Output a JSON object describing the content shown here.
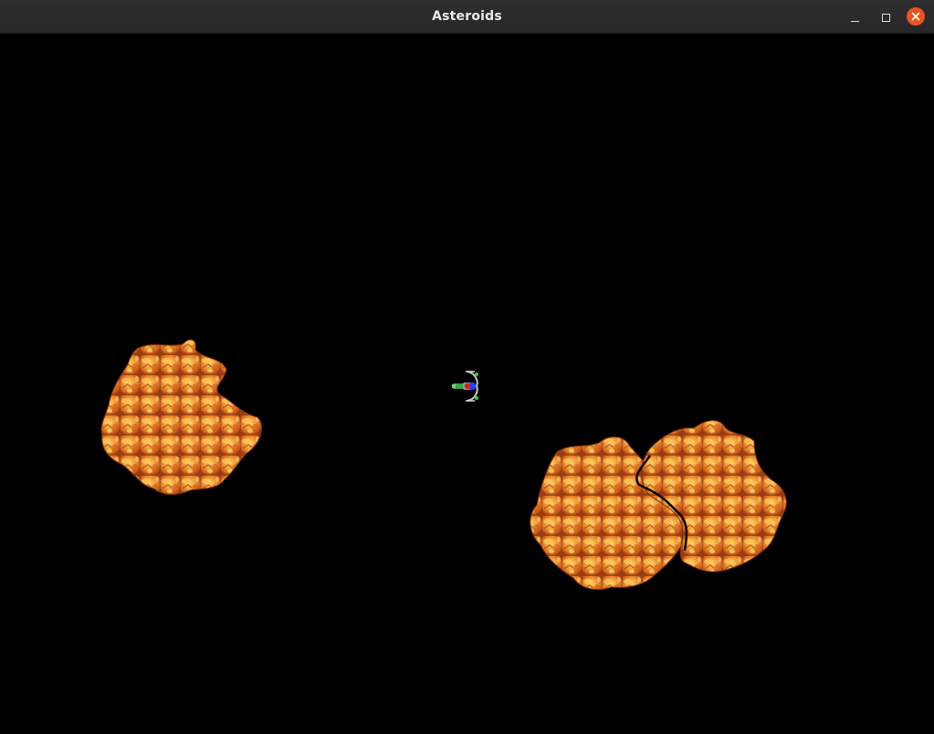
{
  "window": {
    "title": "Asteroids",
    "buttons": {
      "minimize_icon": "minimize-icon",
      "maximize_icon": "maximize-icon",
      "close_icon": "close-icon",
      "close_color": "#e95420"
    }
  },
  "game": {
    "background_color": "#000000",
    "entities": [
      {
        "type": "player-ship",
        "icon": "spaceship-icon"
      },
      {
        "type": "asteroid",
        "icon": "asteroid-icon"
      },
      {
        "type": "asteroid",
        "icon": "asteroid-icon"
      },
      {
        "type": "asteroid",
        "icon": "asteroid-icon"
      }
    ],
    "asteroid_colors": [
      "#f0a030",
      "#e06a1e",
      "#ffd060",
      "#b84a14",
      "#ffb860"
    ]
  }
}
